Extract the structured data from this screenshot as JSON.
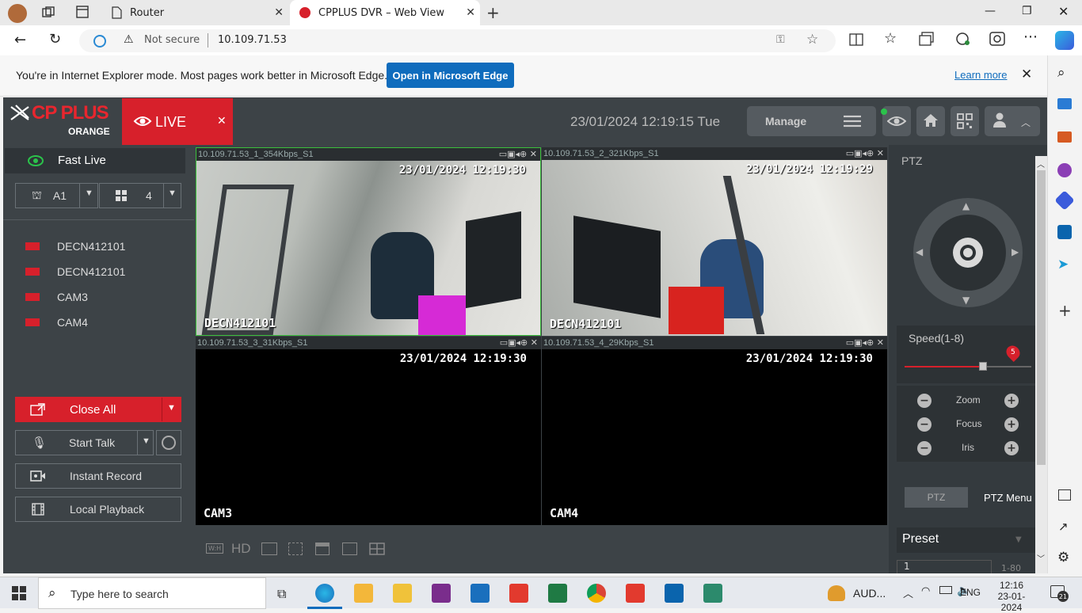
{
  "browser": {
    "tabs": [
      {
        "label": "Router"
      },
      {
        "label": "CPPLUS DVR – Web View"
      }
    ],
    "address": {
      "security": "Not secure",
      "url": "10.109.71.53"
    },
    "ie_banner": {
      "message": "You're in Internet Explorer mode. Most pages work better in Microsoft Edge.",
      "open_button": "Open in Microsoft Edge",
      "learn_more": "Learn more"
    }
  },
  "dvr": {
    "logo": {
      "brand": "CP PLUS",
      "sub": "ORANGE"
    },
    "live_tab": "LIVE",
    "datetime": "23/01/2024 12:19:15 Tue",
    "manage": "Manage",
    "fast_live": "Fast Live",
    "channel_select": "A1",
    "layout_select": "4",
    "devices": [
      {
        "label": "DECN412101"
      },
      {
        "label": "DECN412101"
      },
      {
        "label": "CAM3"
      },
      {
        "label": "CAM4"
      }
    ],
    "buttons": {
      "close_all": "Close All",
      "start_talk": "Start Talk",
      "instant_record": "Instant Record",
      "local_playback": "Local Playback"
    },
    "cameras": [
      {
        "header": "10.109.71.53_1_354Kbps_S1",
        "timestamp": "23/01/2024 12:19:30",
        "name": "DECN412101"
      },
      {
        "header": "10.109.71.53_2_321Kbps_S1",
        "timestamp": "23/01/2024 12:19:29",
        "name": "DECN412101"
      },
      {
        "header": "10.109.71.53_3_31Kbps_S1",
        "timestamp": "23/01/2024 12:19:30",
        "name": "CAM3"
      },
      {
        "header": "10.109.71.53_4_29Kbps_S1",
        "timestamp": "23/01/2024 12:19:30",
        "name": "CAM4"
      }
    ],
    "toolbar": {
      "wh": "W:H",
      "hd": "HD"
    },
    "ptz": {
      "title": "PTZ",
      "speed_label": "Speed(1-8)",
      "speed_value": "5",
      "speed_fraction": 0.62,
      "zoom": "Zoom",
      "focus": "Focus",
      "iris": "Iris",
      "tab_ptz": "PTZ",
      "tab_menu": "PTZ Menu",
      "preset": "Preset",
      "preset_num": "1",
      "preset_range": "1-80"
    }
  },
  "taskbar": {
    "search_placeholder": "Type here to search",
    "audio": "AUD...",
    "lang": "ENG",
    "time": "12:16",
    "date": "23-01-2024",
    "notifications": "21"
  },
  "colors": {
    "accent_red": "#d7202b",
    "edge_blue": "#0f6cbd",
    "dvr_bg": "#3d4347"
  }
}
